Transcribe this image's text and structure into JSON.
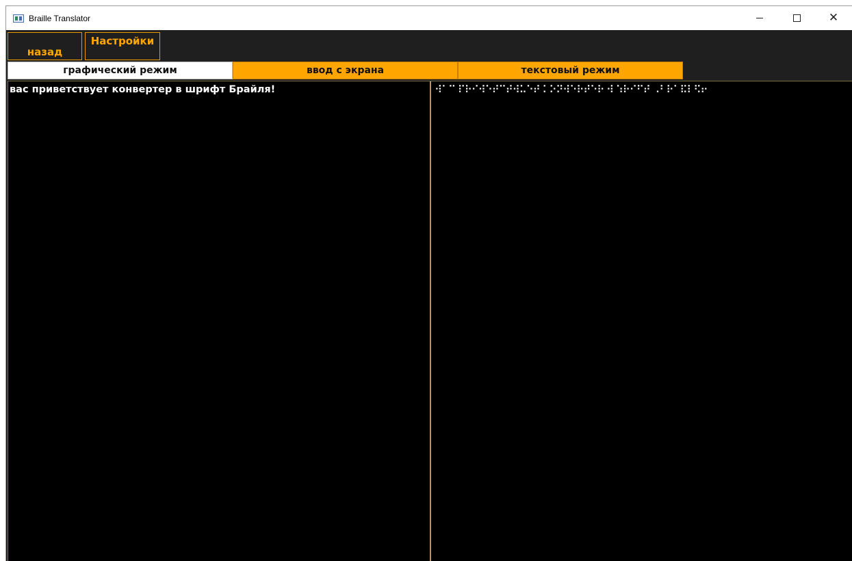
{
  "window": {
    "title": "Braille Translator"
  },
  "toolbar": {
    "back_label": "назад",
    "settings_label": "Настройки"
  },
  "tabs": [
    {
      "label": "графический режим",
      "active": true
    },
    {
      "label": "ввод с экрана",
      "active": false
    },
    {
      "label": "текстовый режим",
      "active": false
    }
  ],
  "input_panel": {
    "text": "вас приветствует конвертер в шрифт Брайля!"
  },
  "output_panel": {
    "braille": "⠺⠁⠉ ⠏⠗⠊⠺⠑⠞⠉⠞⠺⠥⠑⠞ ⠅⠕⠝⠺⠑⠗⠞⠑⠗ ⠺ ⠱⠗⠊⠋⠞ ⠠⠃⠗⠁⠯⠇⠫⠖"
  },
  "colors": {
    "accent": "#FFA500",
    "background": "#000000",
    "chrome": "#1F1F1F"
  }
}
